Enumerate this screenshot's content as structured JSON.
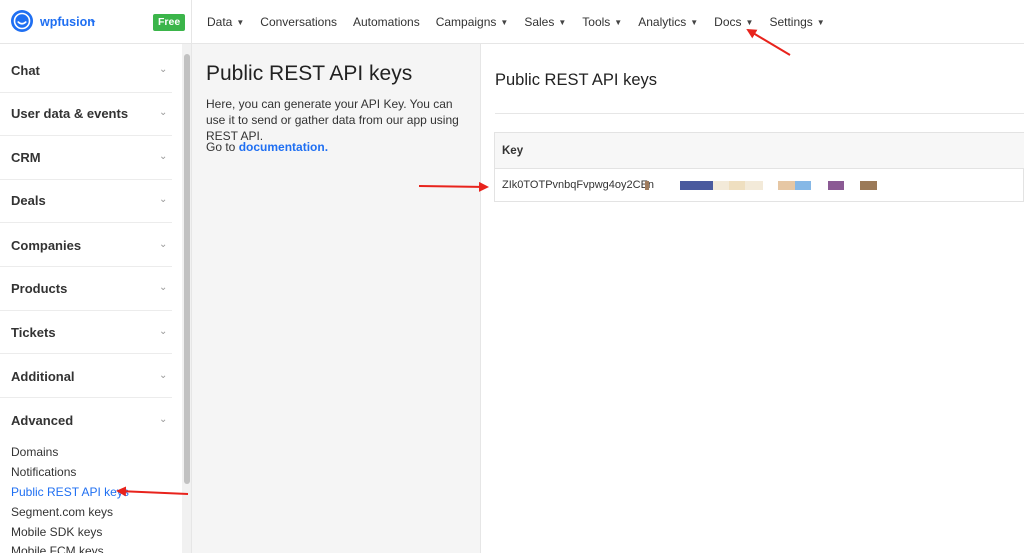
{
  "workspace": {
    "name": "wpfusion",
    "plan_badge": "Free"
  },
  "nav": [
    {
      "label": "Data",
      "has_dropdown": true
    },
    {
      "label": "Conversations",
      "has_dropdown": false
    },
    {
      "label": "Automations",
      "has_dropdown": false
    },
    {
      "label": "Campaigns",
      "has_dropdown": true
    },
    {
      "label": "Sales",
      "has_dropdown": true
    },
    {
      "label": "Tools",
      "has_dropdown": true
    },
    {
      "label": "Analytics",
      "has_dropdown": true
    },
    {
      "label": "Docs",
      "has_dropdown": true
    },
    {
      "label": "Settings",
      "has_dropdown": true
    }
  ],
  "sidebar": {
    "sections": [
      {
        "label": "Chat"
      },
      {
        "label": "User data & events"
      },
      {
        "label": "CRM"
      },
      {
        "label": "Deals"
      },
      {
        "label": "Companies"
      },
      {
        "label": "Products"
      },
      {
        "label": "Tickets"
      },
      {
        "label": "Additional"
      },
      {
        "label": "Advanced"
      }
    ],
    "advanced_links": [
      {
        "label": "Domains",
        "active": false
      },
      {
        "label": "Notifications",
        "active": false
      },
      {
        "label": "Public REST API keys",
        "active": true
      },
      {
        "label": "Segment.com keys",
        "active": false
      },
      {
        "label": "Mobile SDK keys",
        "active": false
      },
      {
        "label": "Mobile FCM keys",
        "active": false
      }
    ]
  },
  "info_panel": {
    "title": "Public REST API keys",
    "description": "Here, you can generate your API Key. You can use it to send or gather data from our app using REST API.",
    "doc_prefix": "Go to",
    "doc_link": "documentation."
  },
  "main": {
    "title": "Public REST API keys",
    "table": {
      "column_header": "Key",
      "key_value": "ZIk0TOTPvnbqFvpwg4oy2CEn"
    }
  },
  "colors": {
    "accent": "#1f6ff2",
    "badge": "#3bb54a",
    "annotation_arrow": "#e8231c",
    "redaction_blocks": [
      "#a07c5e",
      "#4a5a9e",
      "#f3ead9",
      "#efdfc0",
      "#e6c7a4",
      "#86b8e6",
      "#8b5a94",
      "#9b7a58"
    ]
  },
  "icons": {
    "logo": "chat-bubble-logo-icon",
    "dropdown": "chevron-down-icon"
  }
}
